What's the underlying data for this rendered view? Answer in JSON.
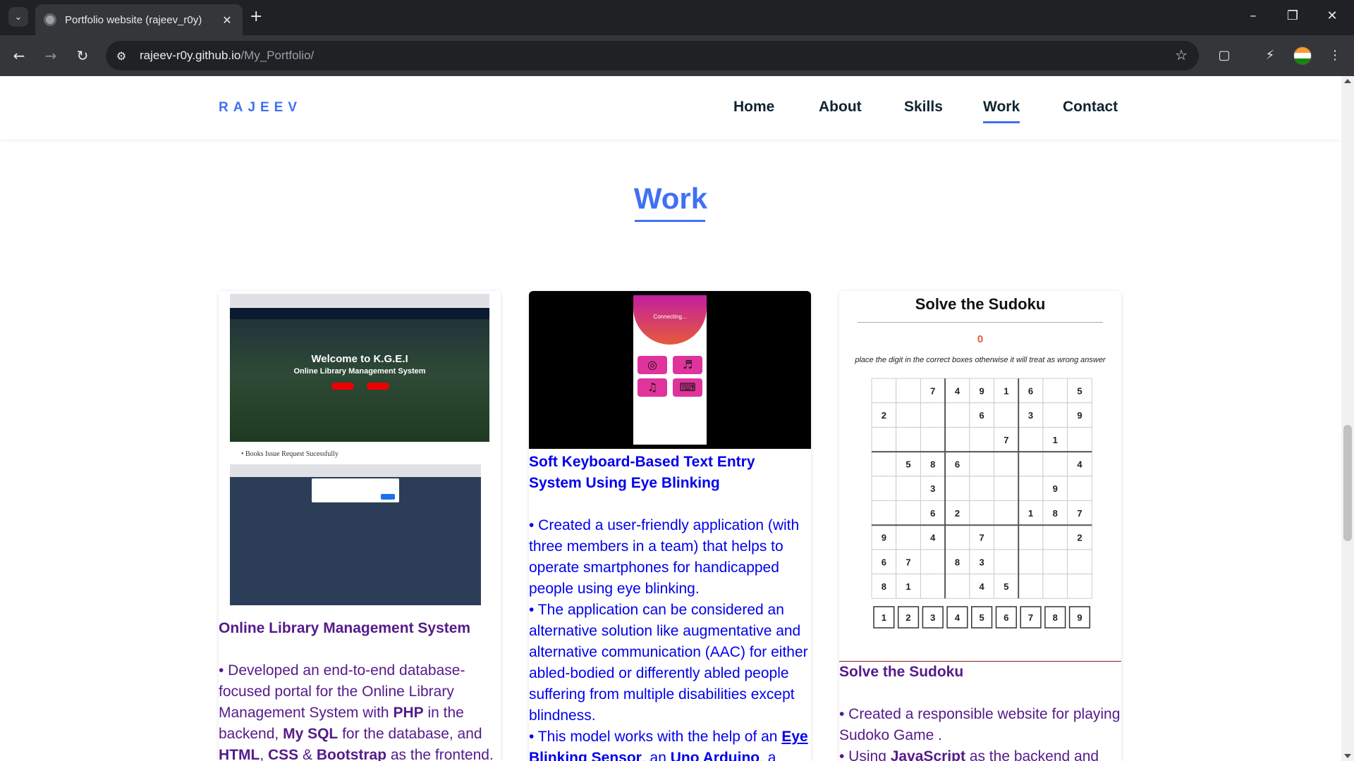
{
  "browser": {
    "tab_title": "Portfolio website (rajeev_r0y)",
    "url_host": "rajeev-r0y.github.io",
    "url_path": "/My_Portfolio/"
  },
  "site": {
    "logo": "RAJEEV",
    "nav": [
      {
        "label": "Home"
      },
      {
        "label": "About"
      },
      {
        "label": "Skills"
      },
      {
        "label": "Work",
        "active": true
      },
      {
        "label": "Contact"
      }
    ]
  },
  "section": {
    "title": "Work"
  },
  "cards": [
    {
      "title": "Online Library Management System",
      "image": {
        "welcome": "Welcome to K.G.E.I",
        "subtitle": "Online Library Management System",
        "note": "• Books Issue Request Sucessfully"
      },
      "text_runs": [
        "• Developed an end-to-end database-focused portal for the Online Library Management System with ",
        {
          "b": "PHP"
        },
        " in the backend, ",
        {
          "b": "My SQL"
        },
        " for the database, and ",
        {
          "b": "HTML"
        },
        ", ",
        {
          "b": "CSS"
        },
        " & ",
        {
          "b": "Bootstrap"
        },
        " as the frontend."
      ]
    },
    {
      "title": "Soft Keyboard-Based Text Entry System Using Eye Blinking",
      "image": {
        "status": "Connecting..."
      },
      "text_runs": [
        "• Created a user-friendly application (with three members in a team) that helps to operate smartphones for handicapped people using eye blinking.",
        {
          "br": true
        },
        "• The application can be considered an alternative solution like augmentative and alternative communication (AAC) for either abled-bodied or differently abled people suffering from multiple disabilities except blindness.",
        {
          "br": true
        },
        "• This model works with the help of an ",
        {
          "bu": "Eye Blinking Sensor"
        },
        ", an ",
        {
          "bu": "Uno Arduino"
        },
        ", a"
      ]
    },
    {
      "title": "Solve the Sudoku",
      "image": {
        "heading": "Solve the Sudoku",
        "score": "0",
        "note": "place the digit in the correct boxes otherwise it will treat as wrong answer",
        "grid": [
          [
            "",
            "",
            "7",
            "4",
            "9",
            "1",
            "6",
            "",
            "5"
          ],
          [
            "2",
            "",
            "",
            "",
            "6",
            "",
            "3",
            "",
            "9"
          ],
          [
            "",
            "",
            "",
            "",
            "",
            "7",
            "",
            "1",
            ""
          ],
          [
            "",
            "5",
            "8",
            "6",
            "",
            "",
            "",
            "",
            "4"
          ],
          [
            "",
            "",
            "3",
            "",
            "",
            "",
            "",
            "9",
            ""
          ],
          [
            "",
            "",
            "6",
            "2",
            "",
            "",
            "1",
            "8",
            "7"
          ],
          [
            "9",
            "",
            "4",
            "",
            "7",
            "",
            "",
            "",
            "2"
          ],
          [
            "6",
            "7",
            "",
            "8",
            "3",
            "",
            "",
            "",
            ""
          ],
          [
            "8",
            "1",
            "",
            "",
            "4",
            "5",
            "",
            "",
            ""
          ]
        ],
        "digits": [
          "1",
          "2",
          "3",
          "4",
          "5",
          "6",
          "7",
          "8",
          "9"
        ]
      },
      "text_runs": [
        "• Created a responsible website for playing Sudoko Game .",
        {
          "br": true
        },
        "• Using ",
        {
          "b": "JavaScript"
        },
        " as the backend and"
      ]
    }
  ],
  "colors": {
    "accent": "#4070f4",
    "visited_link": "#551a8b",
    "link_blue": "#0000ee",
    "text_dark": "#0e2431"
  }
}
